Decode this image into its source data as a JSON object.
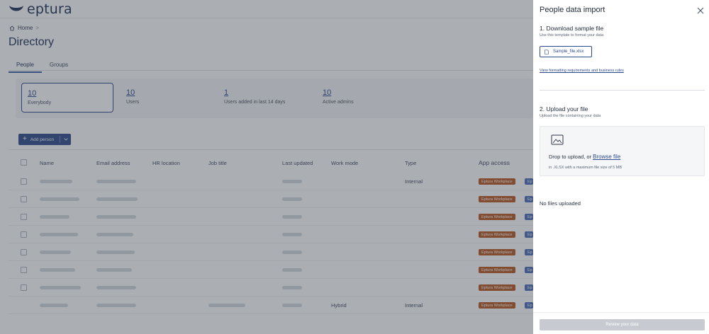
{
  "app": {
    "brand": "eptura",
    "breadcrumb": {
      "home": "Home",
      "separator": ">"
    },
    "page_title": "Directory",
    "tabs": [
      {
        "label": "People",
        "active": true
      },
      {
        "label": "Groups",
        "active": false
      }
    ],
    "stats": [
      {
        "value": "10",
        "label": "Everybody",
        "active": true
      },
      {
        "value": "10",
        "label": "Users",
        "active": false
      },
      {
        "value": "1",
        "label": "Users added in last 14 days",
        "active": false
      },
      {
        "value": "10",
        "label": "Active admins",
        "active": false
      }
    ],
    "add_person_label": "Add person",
    "table": {
      "columns": [
        "Name",
        "Email address",
        "HR location",
        "Job title",
        "Last updated",
        "Work mode",
        "Type",
        "App access"
      ],
      "rows": [
        {
          "work_mode": "",
          "type": "Internal",
          "app_access": "Eptura Workplace",
          "app_access_2": "Ep"
        },
        {
          "work_mode": "",
          "type": "",
          "app_access": "Eptura Workplace",
          "app_access_2": "Ep"
        },
        {
          "work_mode": "",
          "type": "",
          "app_access": "Eptura Workplace",
          "app_access_2": "Ep"
        },
        {
          "work_mode": "",
          "type": "",
          "app_access": "Eptura Workplace",
          "app_access_2": "Ep"
        },
        {
          "work_mode": "",
          "type": "",
          "app_access": "Eptura Workplace",
          "app_access_2": "Ep"
        },
        {
          "work_mode": "",
          "type": "",
          "app_access": "Eptura Workplace",
          "app_access_2": "Ep"
        },
        {
          "work_mode": "",
          "type": "",
          "app_access": "Eptura Workplace",
          "app_access_2": "Ep"
        },
        {
          "work_mode": "Hybrid",
          "type": "Internal",
          "app_access": "Eptura Workplace",
          "app_access_2": "Ep"
        }
      ]
    },
    "colors": {
      "brand": "#1b2f55",
      "primary": "#2d4a8a",
      "badge_orange": "#b9561f",
      "badge_blue": "#4d6fb5"
    }
  },
  "drawer": {
    "title": "People data import",
    "step1": {
      "title": "1. Download sample file",
      "subtitle": "Use this template to format your data",
      "file_button": "Sample_file.xlsx",
      "rules_link": "View formatting requirements and business rules"
    },
    "step2": {
      "title": "2. Upload your file",
      "subtitle": "Upload the file containing your data",
      "drop_text": "Drop to upload, or",
      "browse_link": "Browse file",
      "hint": "in .XLSX with a maximum file size of 5 MB"
    },
    "no_files": "No files uploaded",
    "review_button": "Review your data"
  }
}
